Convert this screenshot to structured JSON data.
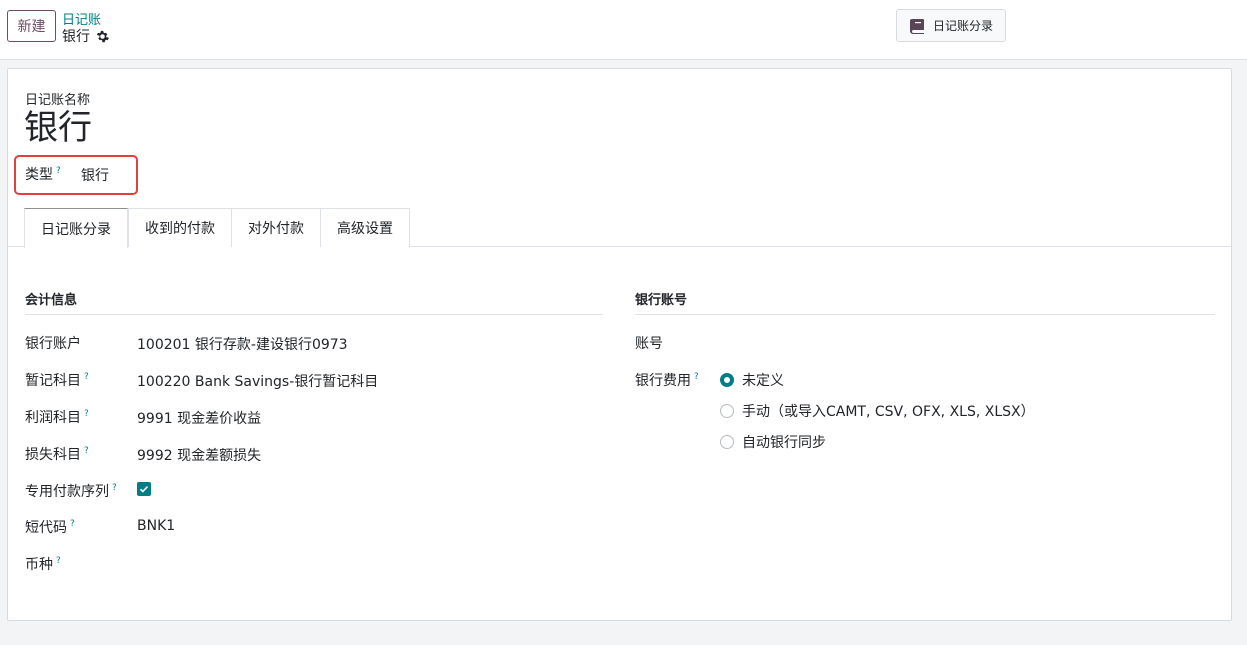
{
  "topbar": {
    "new_button": "新建",
    "breadcrumb_parent": "日记账",
    "breadcrumb_current": "银行",
    "journal_entries_button": "日记账分录"
  },
  "form": {
    "name_label": "日记账名称",
    "name_value": "银行",
    "type_label": "类型",
    "type_help": "?",
    "type_value": "银行"
  },
  "tabs": [
    "日记账分录",
    "收到的付款",
    "对外付款",
    "高级设置"
  ],
  "accounting": {
    "title": "会计信息",
    "rows": [
      {
        "label": "银行账户",
        "help": "",
        "value": "100201 银行存款-建设银行0973"
      },
      {
        "label": "暂记科目",
        "help": "?",
        "value": "100220 Bank Savings-银行暂记科目"
      },
      {
        "label": "利润科目",
        "help": "?",
        "value": "9991 现金差价收益"
      },
      {
        "label": "损失科目",
        "help": "?",
        "value": "9992 现金差额损失"
      },
      {
        "label": "专用付款序列",
        "help": "?",
        "value": ""
      },
      {
        "label": "短代码",
        "help": "?",
        "value": "BNK1"
      },
      {
        "label": "币种",
        "help": "?",
        "value": ""
      }
    ],
    "dedicated_sequence_checked": true
  },
  "bank": {
    "title": "银行账号",
    "account_label": "账号",
    "fees_label": "银行费用",
    "fees_help": "?",
    "options": [
      {
        "label": "未定义",
        "selected": true
      },
      {
        "label": "手动（或导入CAMT, CSV, OFX, XLS, XLSX）",
        "selected": false
      },
      {
        "label": "自动银行同步",
        "selected": false
      }
    ]
  },
  "colors": {
    "brand": "#714b67",
    "accent": "#017e84",
    "highlight": "#e0413b"
  }
}
